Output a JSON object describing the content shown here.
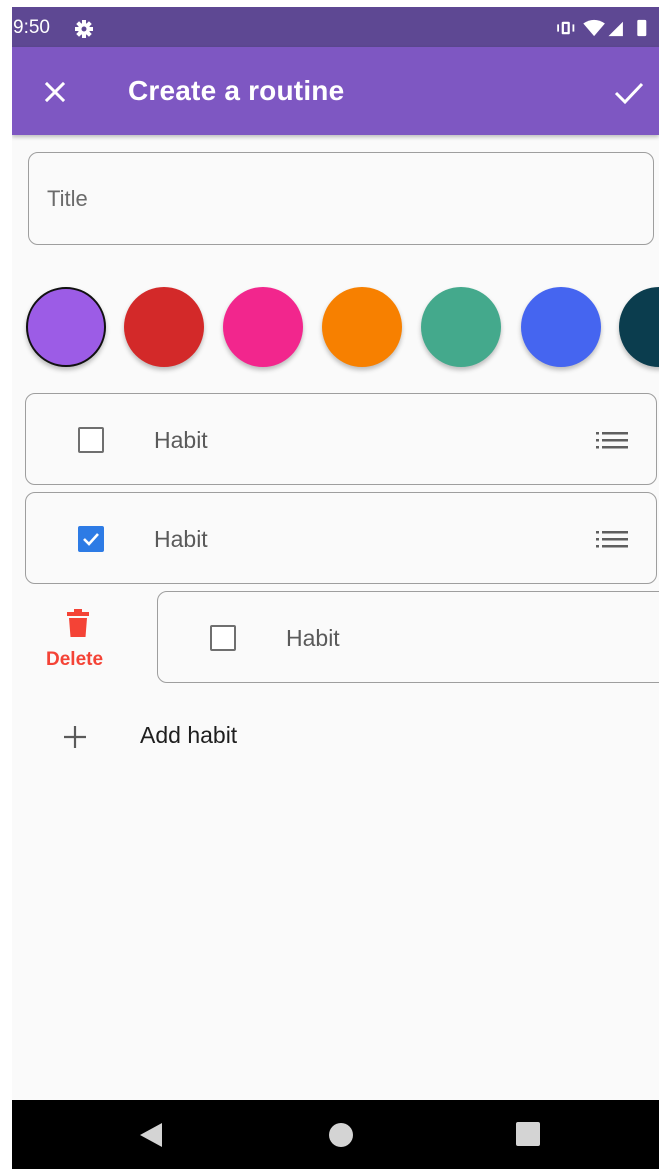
{
  "status_bar": {
    "time": "9:50",
    "icons": [
      "settings-gear-icon",
      "vibrate-icon",
      "wifi-icon",
      "signal-icon",
      "battery-icon"
    ]
  },
  "app_bar": {
    "title": "Create a routine",
    "close_icon": "close-icon",
    "confirm_icon": "check-icon",
    "background": "#7e57c2"
  },
  "title_field": {
    "placeholder": "Title",
    "value": ""
  },
  "colors": [
    {
      "name": "purple",
      "hex": "#9c5ce6",
      "selected": true
    },
    {
      "name": "red",
      "hex": "#d32929"
    },
    {
      "name": "pink",
      "hex": "#f2268d"
    },
    {
      "name": "orange",
      "hex": "#f78000"
    },
    {
      "name": "teal",
      "hex": "#44a98c"
    },
    {
      "name": "blue",
      "hex": "#4565f0"
    },
    {
      "name": "dark-teal",
      "hex": "#0b3d4e"
    }
  ],
  "habits": [
    {
      "label": "Habit",
      "checked": false
    },
    {
      "label": "Habit",
      "checked": true
    },
    {
      "label": "Habit",
      "checked": false
    }
  ],
  "delete_action": {
    "label": "Delete",
    "icon": "trash-icon",
    "color": "#f44336"
  },
  "add_habit": {
    "label": "Add habit",
    "icon": "plus-icon"
  },
  "nav_bar": {
    "icons": [
      "back-icon",
      "home-icon",
      "recents-icon"
    ]
  }
}
